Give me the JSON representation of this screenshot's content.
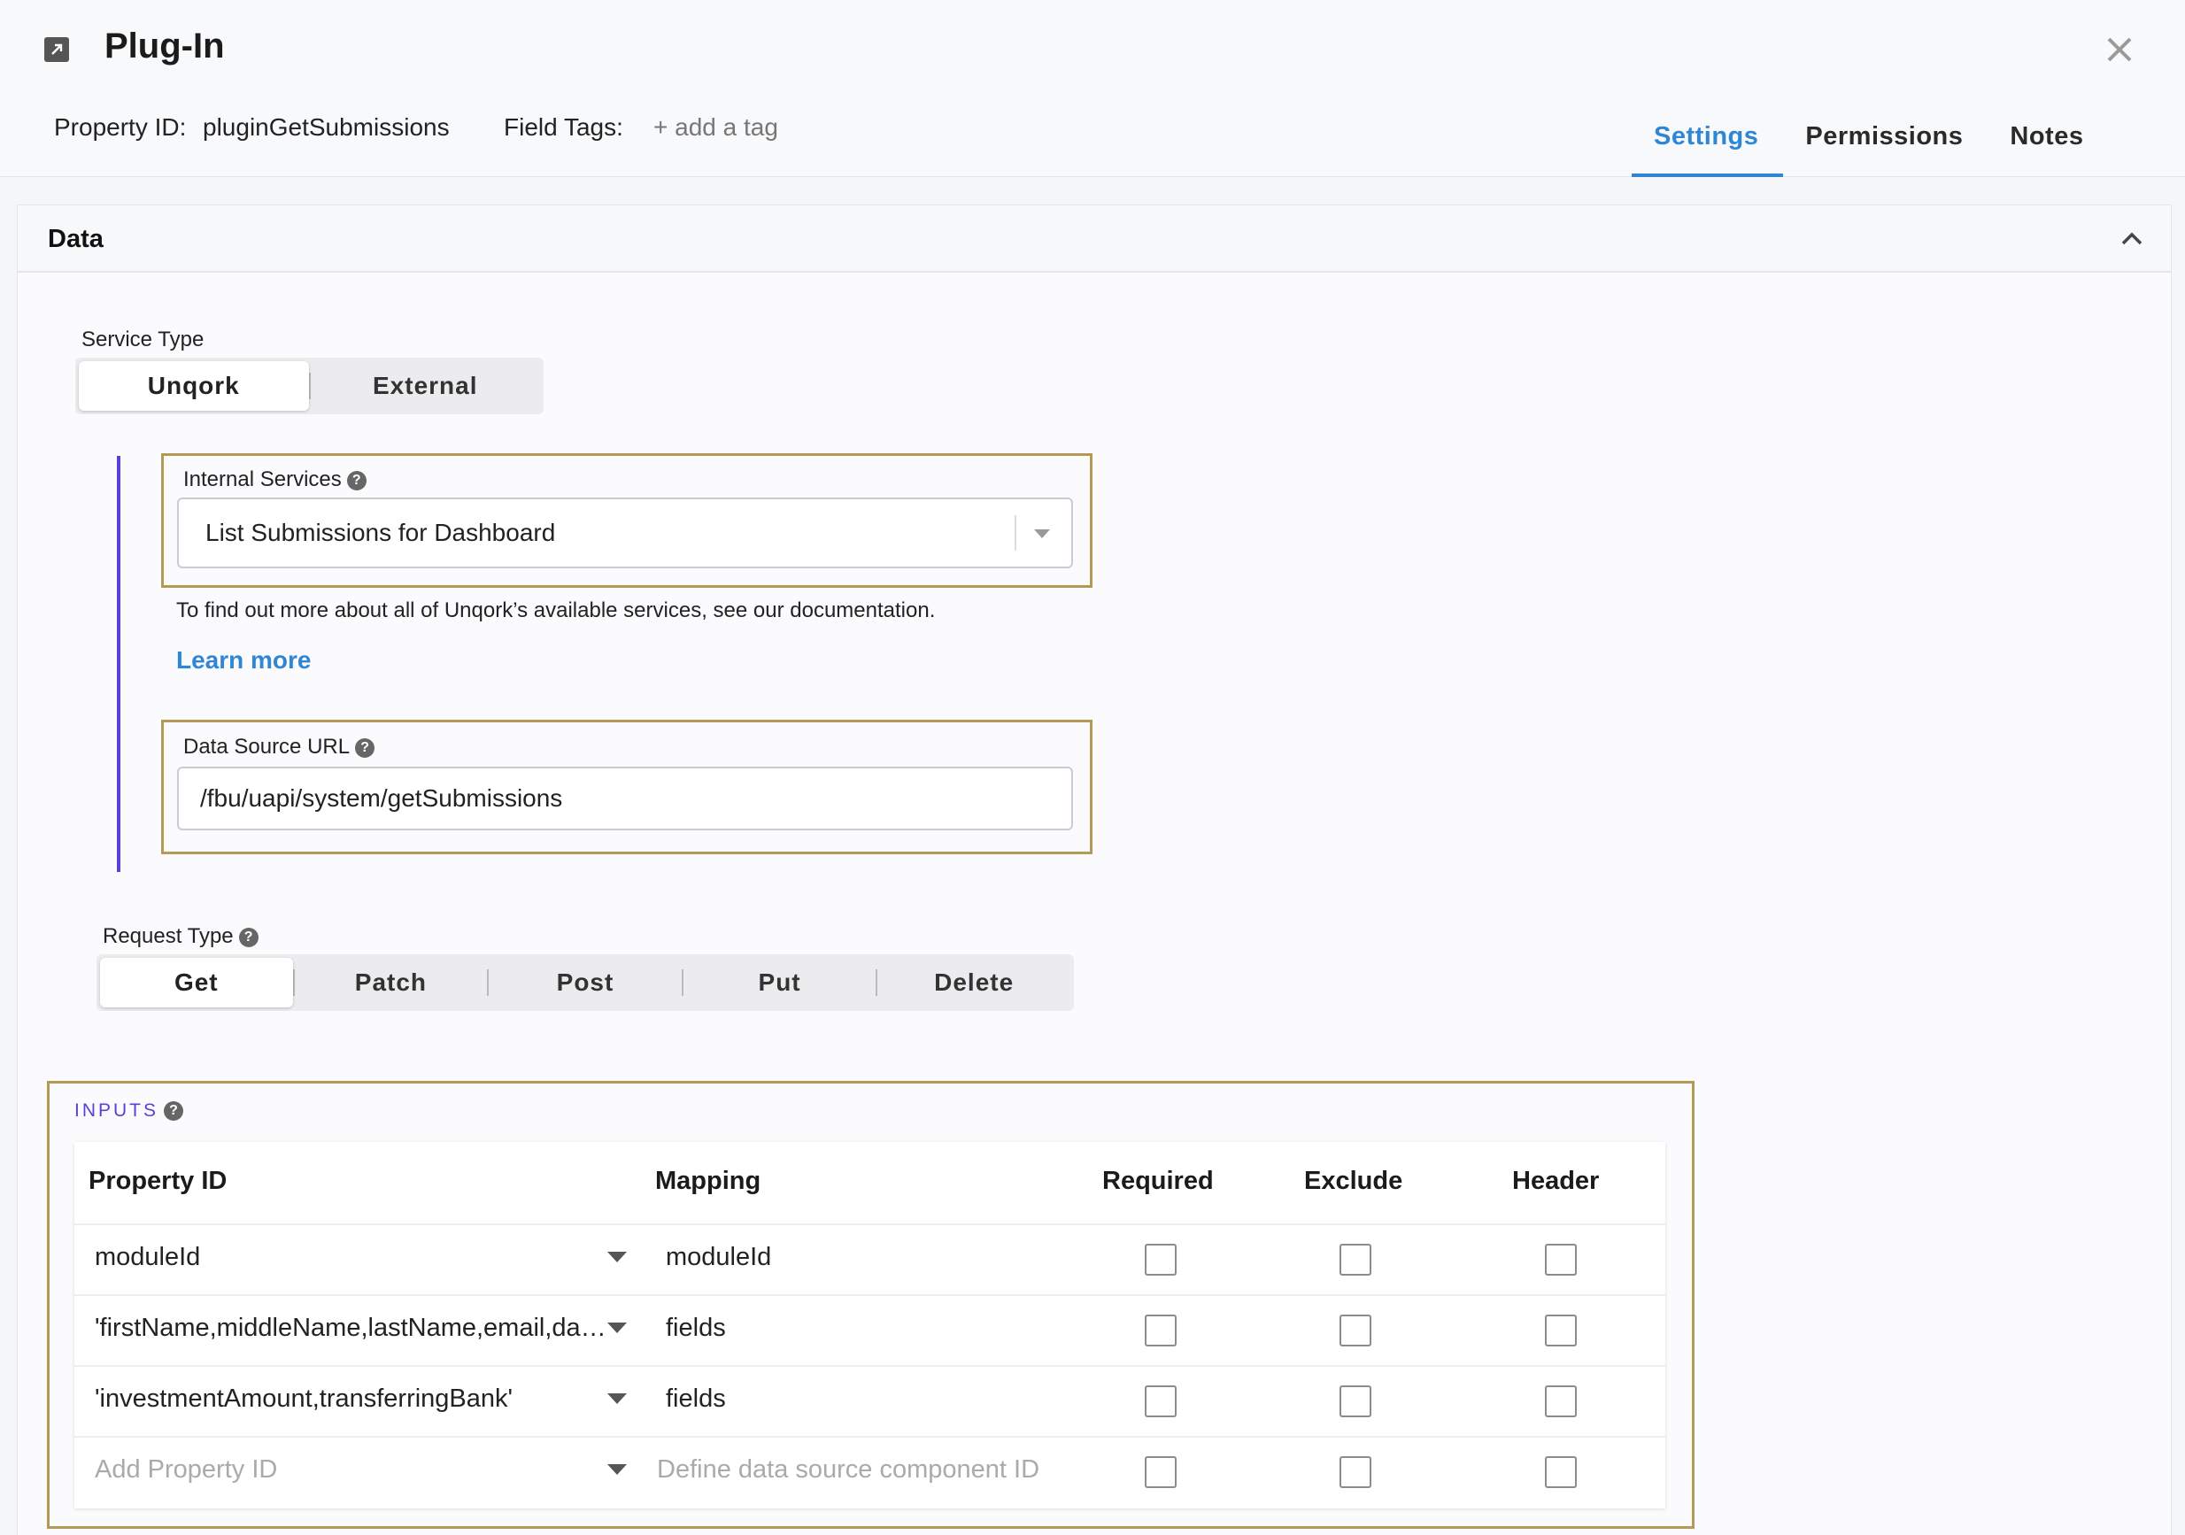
{
  "header": {
    "title": "Plug-In",
    "property_id_label": "Property ID:",
    "property_id_value": "pluginGetSubmissions",
    "field_tags_label": "Field Tags:",
    "add_tag": "+ add a tag",
    "tabs": [
      {
        "label": "Settings",
        "active": true
      },
      {
        "label": "Permissions",
        "active": false
      },
      {
        "label": "Notes",
        "active": false
      }
    ]
  },
  "section": {
    "title": "Data",
    "service_type": {
      "label": "Service Type",
      "options": [
        "Unqork",
        "External"
      ],
      "selected": "Unqork"
    },
    "internal_services": {
      "label": "Internal Services",
      "value": "List Submissions for Dashboard"
    },
    "helper_text": "To find out more about all of Unqork’s available services, see our documentation.",
    "learn_more": "Learn more",
    "data_source_url": {
      "label": "Data Source URL",
      "value": "/fbu/uapi/system/getSubmissions"
    },
    "request_type": {
      "label": "Request Type",
      "options": [
        "Get",
        "Patch",
        "Post",
        "Put",
        "Delete"
      ],
      "selected": "Get"
    },
    "inputs": {
      "label": "INPUTS",
      "columns": [
        "Property ID",
        "Mapping",
        "Required",
        "Exclude",
        "Header"
      ],
      "rows": [
        {
          "property_id": "moduleId",
          "mapping": "moduleId",
          "required": false,
          "exclude": false,
          "header": false
        },
        {
          "property_id": "'firstName,middleName,lastName,email,da…",
          "mapping": "fields",
          "required": false,
          "exclude": false,
          "header": false
        },
        {
          "property_id": "'investmentAmount,transferringBank'",
          "mapping": "fields",
          "required": false,
          "exclude": false,
          "header": false
        }
      ],
      "new_row": {
        "property_placeholder": "Add Property ID",
        "mapping_placeholder": "Define data source component ID"
      }
    }
  },
  "colors": {
    "accent": "#2e86d4",
    "purple": "#5b3fd6",
    "highlight_border": "#b39a55"
  }
}
